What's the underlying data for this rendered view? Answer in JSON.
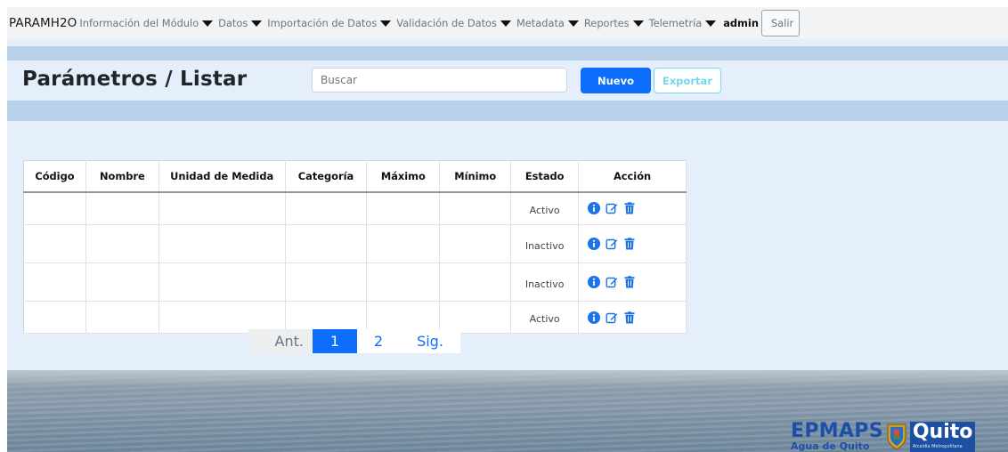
{
  "navbar": {
    "brand": "PARAMH2O",
    "items": [
      {
        "label": "Información del Módulo"
      },
      {
        "label": "Datos"
      },
      {
        "label": "Importación de Datos"
      },
      {
        "label": "Validación de Datos"
      },
      {
        "label": "Metadata"
      },
      {
        "label": "Reportes"
      },
      {
        "label": "Telemetría"
      }
    ],
    "user": "admin",
    "logout_label": "Salir"
  },
  "header": {
    "title": "Parámetros / Listar",
    "search_placeholder": "Buscar",
    "search_value": "",
    "new_label": "Nuevo",
    "export_label": "Exportar"
  },
  "table": {
    "columns": [
      "Código",
      "Nombre",
      "Unidad de Medida",
      "Categoría",
      "Máximo",
      "Mínimo",
      "Estado",
      "Acción"
    ],
    "rows": [
      {
        "codigo": "",
        "nombre": "",
        "unidad": "",
        "categoria": "",
        "maximo": "",
        "minimo": "",
        "estado": "Activo"
      },
      {
        "codigo": "",
        "nombre": "",
        "unidad": "",
        "categoria": "",
        "maximo": "",
        "minimo": "",
        "estado": "Inactivo"
      },
      {
        "codigo": "",
        "nombre": "",
        "unidad": "",
        "categoria": "",
        "maximo": "",
        "minimo": "",
        "estado": "Inactivo"
      },
      {
        "codigo": "",
        "nombre": "",
        "unidad": "",
        "categoria": "",
        "maximo": "",
        "minimo": "",
        "estado": "Activo"
      }
    ],
    "action_icons": [
      "info-icon",
      "edit-icon",
      "trash-icon"
    ]
  },
  "pagination": {
    "prev_label": "Ant.",
    "pages": [
      "1",
      "2"
    ],
    "current_page": "1",
    "next_label": "Sig."
  },
  "footer_logo": {
    "main": "EPMAPS",
    "sub": "Agua de Quito",
    "city": "Quito",
    "tagline": "Alcaldía Metropolitana"
  },
  "colors": {
    "primary": "#0d6efd",
    "info_outline": "#76d6f0",
    "band": "#b7d2ea",
    "page_bg": "#e4effb",
    "logo_blue": "#1e4fa8"
  }
}
